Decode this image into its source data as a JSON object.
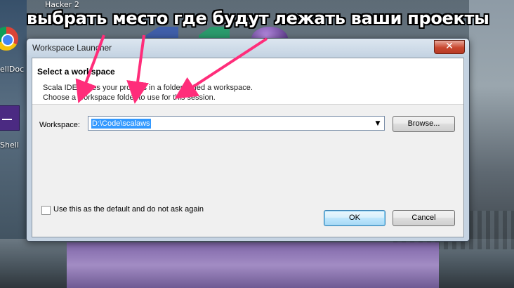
{
  "annotation": {
    "text": "выбрать место где будут лежать ваши проекты",
    "color": "#ff2d7a"
  },
  "desktop": {
    "icons": [
      {
        "label": "Hacker 2",
        "icon": "app-icon"
      },
      {
        "label": "ellDoc",
        "icon": "chrome-icon"
      },
      {
        "label": "Shell",
        "icon": "shell-icon"
      }
    ]
  },
  "dialog": {
    "title": "Workspace Launcher",
    "close_label": "✕",
    "header": {
      "title": "Select a workspace",
      "line1": "Scala IDE stores your projects in a folder called a workspace.",
      "line2": "Choose a workspace folder to use for this session."
    },
    "workspace": {
      "label": "Workspace:",
      "value": "D:\\Code\\scalaws",
      "dropdown_icon": "chevron-down-icon"
    },
    "browse_label": "Browse...",
    "default_checkbox": {
      "label": "Use this as the default and do not ask again",
      "checked": false
    },
    "ok_label": "OK",
    "cancel_label": "Cancel"
  }
}
